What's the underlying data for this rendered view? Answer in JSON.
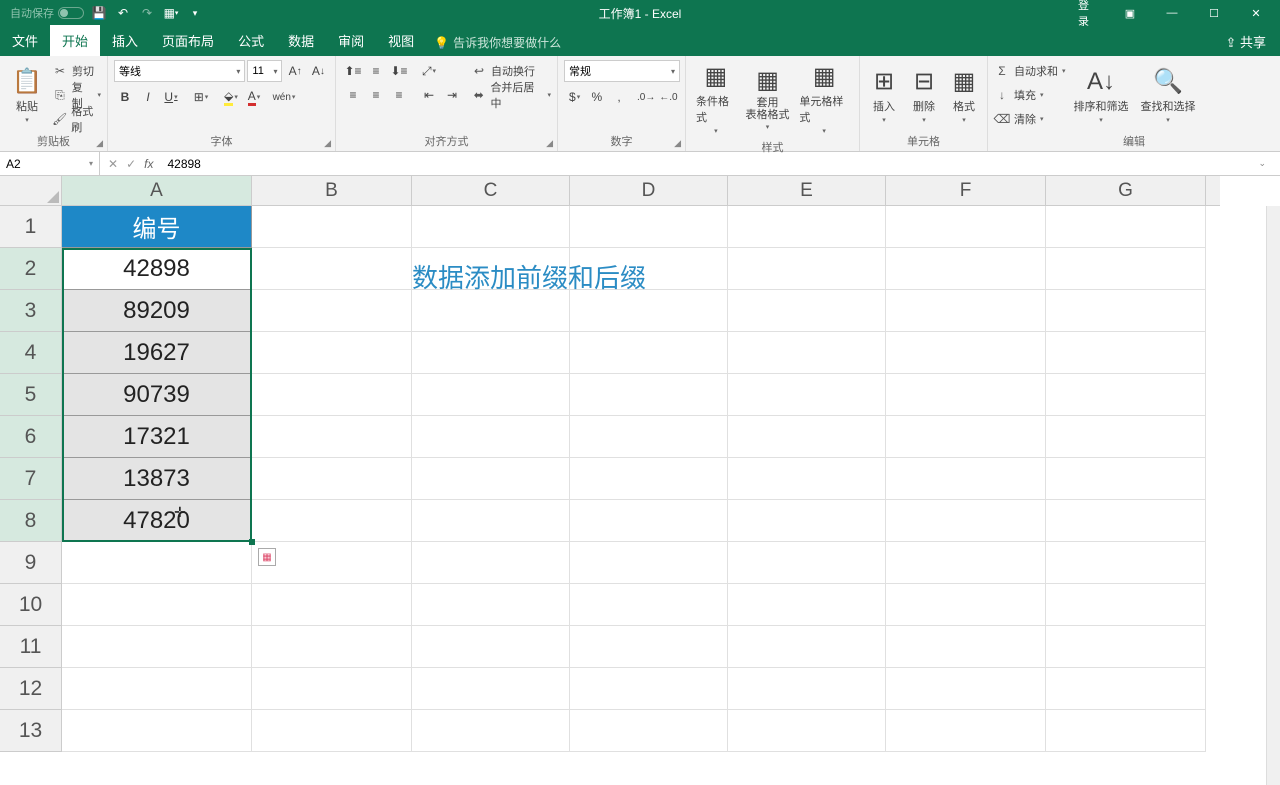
{
  "titlebar": {
    "autosave": "自动保存",
    "title": "工作簿1 - Excel",
    "login": "登录"
  },
  "tabs": {
    "file": "文件",
    "home": "开始",
    "insert": "插入",
    "pagelayout": "页面布局",
    "formulas": "公式",
    "data": "数据",
    "review": "审阅",
    "view": "视图",
    "tellme": "告诉我你想要做什么",
    "share": "共享"
  },
  "ribbon": {
    "clipboard": {
      "paste": "粘贴",
      "cut": "剪切",
      "copy": "复制",
      "fmtpainter": "格式刷",
      "label": "剪贴板"
    },
    "font": {
      "name": "等线",
      "size": "11",
      "label": "字体"
    },
    "align": {
      "wrap": "自动换行",
      "merge": "合并后居中",
      "label": "对齐方式"
    },
    "number": {
      "format": "常规",
      "label": "数字"
    },
    "styles": {
      "condfmt": "条件格式",
      "tablefmt": "套用\n表格格式",
      "cellstyle": "单元格样式",
      "label": "样式"
    },
    "cells": {
      "insert": "插入",
      "delete": "删除",
      "format": "格式",
      "label": "单元格"
    },
    "editing": {
      "sum": "自动求和",
      "fill": "填充",
      "clear": "清除",
      "sort": "排序和筛选",
      "find": "查找和选择",
      "label": "编辑"
    }
  },
  "namebox": "A2",
  "formula": "42898",
  "columns": [
    "A",
    "B",
    "C",
    "D",
    "E",
    "F",
    "G"
  ],
  "rows": [
    "1",
    "2",
    "3",
    "4",
    "5",
    "6",
    "7",
    "8",
    "9",
    "10",
    "11",
    "12",
    "13"
  ],
  "sheet": {
    "a1": "编号",
    "a2": "42898",
    "a3": "89209",
    "a4": "19627",
    "a5": "90739",
    "a6": "17321",
    "a7": "13873",
    "a8": "47820",
    "overlay": "数据添加前缀和后缀"
  }
}
